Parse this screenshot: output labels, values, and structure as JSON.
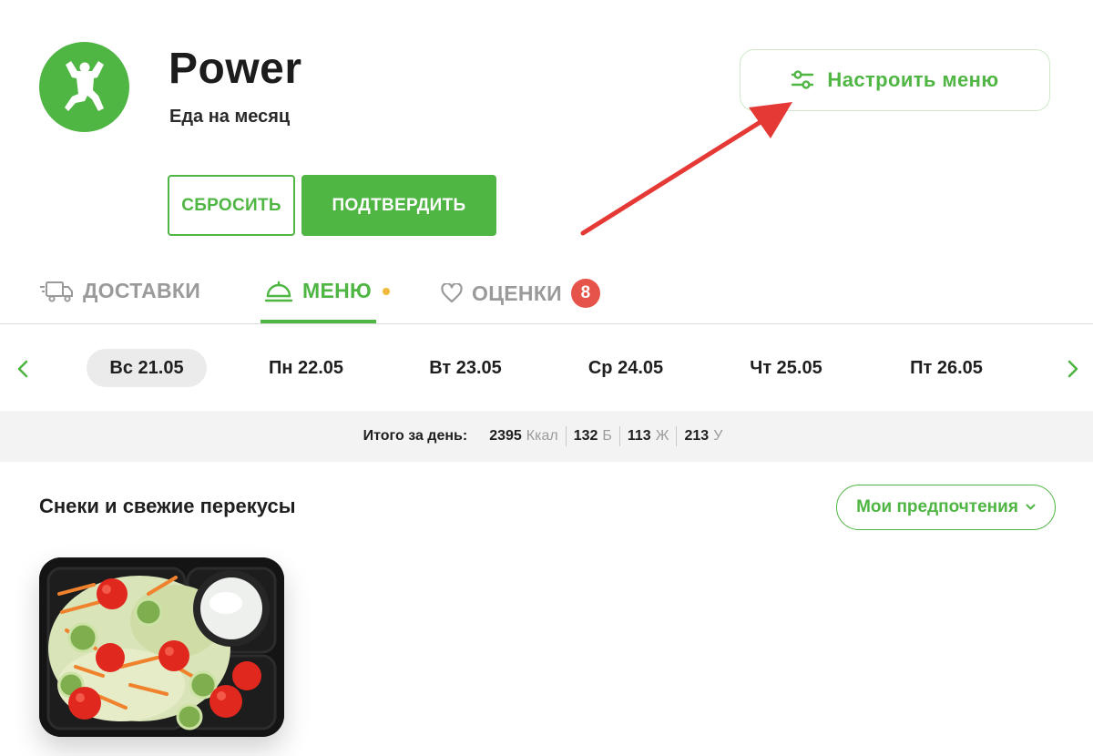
{
  "colors": {
    "accent": "#4fb543",
    "badge": "#e5534b",
    "dot": "#f2b93a",
    "arrow": "#e53935"
  },
  "header": {
    "logo_icon": "bodybuilder-icon",
    "title": "Power",
    "subtitle": "Еда на месяц"
  },
  "actions": {
    "reset_label": "СБРОСИТЬ",
    "confirm_label": "ПОДТВЕРДИТЬ",
    "configure_label": "Настроить меню",
    "configure_icon": "sliders-icon"
  },
  "tabs": [
    {
      "label": "ДОСТАВКИ",
      "icon": "truck-icon"
    },
    {
      "label": "МЕНЮ",
      "icon": "cloche-icon",
      "active": true
    },
    {
      "label": "ОЦЕНКИ",
      "icon": "heart-icon",
      "badge": "8"
    }
  ],
  "days": [
    {
      "label": "Вс 21.05",
      "selected": true
    },
    {
      "label": "Пн 22.05"
    },
    {
      "label": "Вт 23.05"
    },
    {
      "label": "Ср 24.05"
    },
    {
      "label": "Чт 25.05"
    },
    {
      "label": "Пт 26.05"
    }
  ],
  "summary": {
    "label": "Итого за день:",
    "kcal": "2395",
    "kcal_unit": "Ккал",
    "protein": "132",
    "protein_unit": "Б",
    "fat": "113",
    "fat_unit": "Ж",
    "carbs": "213",
    "carbs_unit": "У"
  },
  "section": {
    "title": "Снеки и свежие перекусы",
    "prefs_label": "Мои предпочтения"
  }
}
